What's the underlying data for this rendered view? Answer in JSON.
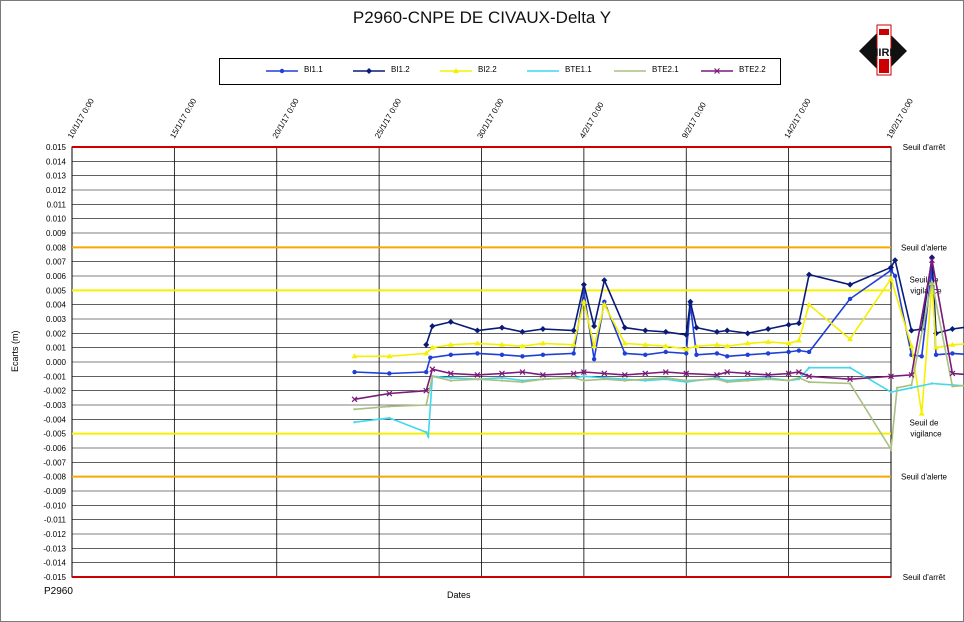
{
  "chart_data": {
    "type": "line",
    "title": "P2960-CNPE DE CIVAUX-Delta Y",
    "xlabel": "Dates",
    "ylabel": "Ecarts (m)",
    "footer": "P2960",
    "ylim": [
      -0.015,
      0.015
    ],
    "x_ticks": [
      "10/1/17 0:00",
      "15/1/17 0:00",
      "20/1/17 0:00",
      "25/1/17 0:00",
      "30/1/17 0:00",
      "4/2/17 0:00",
      "9/2/17 0:00",
      "14/2/17 0:00",
      "19/2/17 0:00"
    ],
    "y_ticks": [
      "0.015",
      "0.014",
      "0.013",
      "0.012",
      "0.011",
      "0.010",
      "0.009",
      "0.008",
      "0.007",
      "0.006",
      "0.005",
      "0.004",
      "0.003",
      "0.002",
      "0.001",
      "0.000",
      "-0.001",
      "-0.002",
      "-0.003",
      "-0.004",
      "-0.005",
      "-0.006",
      "-0.007",
      "-0.008",
      "-0.009",
      "-0.010",
      "-0.011",
      "-0.012",
      "-0.013",
      "-0.014",
      "-0.015"
    ],
    "thresholds": [
      {
        "value": 0.015,
        "label": "Seuil d'arrêt",
        "color": "#cc0000"
      },
      {
        "value": 0.008,
        "label": "Seuil d'alerte",
        "color": "#f5a800"
      },
      {
        "value": 0.005,
        "label": "Seuil de vigilance",
        "color": "#f5f000"
      },
      {
        "value": -0.005,
        "label": "Seuil de vigilance",
        "color": "#f5f000"
      },
      {
        "value": -0.008,
        "label": "Seuil d'alerte",
        "color": "#f5a800"
      },
      {
        "value": -0.015,
        "label": "Seuil d'arrêt",
        "color": "#cc0000"
      }
    ],
    "grid": true,
    "legend_position": "top",
    "series": [
      {
        "name": "BI1.1",
        "color": "#1f3fd6",
        "marker": "circle",
        "x": [
          13.8,
          15.5,
          17.3,
          17.5,
          18.5,
          19.8,
          21,
          22,
          23,
          24.5,
          25,
          25.5,
          26,
          27,
          28,
          29,
          30,
          30.2,
          30.5,
          31.5,
          32,
          33,
          34,
          35,
          35.5,
          36,
          38,
          40,
          40.2,
          41,
          41.5,
          42,
          42.2,
          43,
          44,
          45,
          46,
          46.8,
          47,
          47.1
        ],
        "y": [
          -0.0007,
          -0.0008,
          -0.0007,
          0.0003,
          0.0005,
          0.0006,
          0.0005,
          0.0004,
          0.0005,
          0.0006,
          0.0049,
          0.0002,
          0.0042,
          0.0006,
          0.0005,
          0.0007,
          0.0006,
          0.004,
          0.0005,
          0.0006,
          0.0004,
          0.0005,
          0.0006,
          0.0007,
          0.0008,
          0.0007,
          0.0044,
          0.0064,
          0.006,
          0.0005,
          0.0004,
          0.0066,
          0.0005,
          0.0006,
          0.0005,
          0.0004,
          0.0005,
          0.0003,
          0.0088,
          0.0004
        ]
      },
      {
        "name": "BI1.2",
        "color": "#0a1a78",
        "marker": "diamond",
        "x": [
          17.3,
          17.6,
          18.5,
          19.8,
          21,
          22,
          23,
          24.5,
          25,
          25.5,
          26,
          27,
          28,
          29,
          30,
          30.2,
          30.5,
          31.5,
          32,
          33,
          34,
          35,
          35.5,
          36,
          38,
          40,
          40.2,
          41,
          41.5,
          42,
          42.2,
          43,
          44,
          45,
          46,
          46.8,
          47,
          47.1
        ],
        "y": [
          0.0012,
          0.0025,
          0.0028,
          0.0022,
          0.0024,
          0.0021,
          0.0023,
          0.0022,
          0.0054,
          0.0025,
          0.0057,
          0.0024,
          0.0022,
          0.0021,
          0.0019,
          0.0042,
          0.0024,
          0.0021,
          0.0022,
          0.002,
          0.0023,
          0.0026,
          0.0027,
          0.0061,
          0.0054,
          0.0066,
          0.0071,
          0.0022,
          0.0023,
          0.0073,
          0.002,
          0.0023,
          0.0025,
          0.0024,
          0.0022,
          0.0019,
          0.0097,
          0.0014
        ]
      },
      {
        "name": "BI2.2",
        "color": "#f5f000",
        "marker": "triangle",
        "x": [
          13.8,
          15.5,
          17.3,
          17.6,
          18.5,
          19.8,
          21,
          22,
          23,
          24.5,
          25,
          25.5,
          26,
          27,
          28,
          29,
          30,
          30.5,
          31.5,
          32,
          33,
          34,
          35,
          35.5,
          36,
          38,
          40,
          41,
          41.5,
          42,
          42.2,
          43,
          44,
          45,
          46,
          46.8,
          47
        ],
        "y": [
          0.0004,
          0.0004,
          0.0006,
          0.001,
          0.0012,
          0.0013,
          0.0012,
          0.0011,
          0.0013,
          0.0012,
          0.0042,
          0.0011,
          0.004,
          0.0013,
          0.0012,
          0.0011,
          0.0009,
          0.0011,
          0.0012,
          0.0011,
          0.0013,
          0.0014,
          0.0013,
          0.0015,
          0.004,
          0.0016,
          0.0058,
          0.0011,
          -0.0036,
          0.0055,
          0.001,
          0.0012,
          0.0013,
          0.0012,
          0.0011,
          0.001,
          0.0009
        ]
      },
      {
        "name": "BTE1.1",
        "color": "#3fd8f0",
        "marker": "none",
        "x": [
          13.8,
          15.5,
          17.3,
          17.4,
          17.6,
          18.5,
          19.8,
          21,
          22,
          23,
          24.5,
          25,
          26,
          27,
          28,
          29,
          30,
          31.5,
          32,
          33,
          34,
          35,
          35.5,
          36,
          38,
          40,
          41,
          42,
          43,
          44,
          45,
          46,
          47
        ],
        "y": [
          -0.0042,
          -0.0039,
          -0.0049,
          -0.0052,
          -0.001,
          -0.0011,
          -0.0012,
          -0.0011,
          -0.0013,
          -0.0012,
          -0.0011,
          -0.001,
          -0.0011,
          -0.0012,
          -0.0013,
          -0.0012,
          -0.0014,
          -0.0011,
          -0.0013,
          -0.0012,
          -0.0011,
          -0.0013,
          -0.0012,
          -0.0004,
          -0.0004,
          -0.0021,
          -0.0018,
          -0.0015,
          -0.0016,
          -0.0017,
          -0.0016,
          -0.0015,
          -0.0017
        ]
      },
      {
        "name": "BTE2.1",
        "color": "#a8c080",
        "marker": "none",
        "x": [
          13.8,
          15.5,
          17.3,
          17.6,
          18.5,
          19.8,
          21,
          22,
          23,
          24.5,
          25,
          26,
          27,
          28,
          29,
          30,
          31.5,
          32,
          33,
          34,
          35,
          35.5,
          36,
          38,
          40,
          40.3,
          41,
          42,
          43,
          44,
          45,
          46,
          46.8,
          47
        ],
        "y": [
          -0.0033,
          -0.0031,
          -0.003,
          -0.001,
          -0.0013,
          -0.0012,
          -0.0013,
          -0.0014,
          -0.0012,
          -0.0011,
          -0.0013,
          -0.0012,
          -0.0013,
          -0.0012,
          -0.0011,
          -0.0013,
          -0.0012,
          -0.0014,
          -0.0013,
          -0.0012,
          -0.0013,
          -0.0011,
          -0.0014,
          -0.0015,
          -0.0061,
          -0.0018,
          -0.0016,
          0.0056,
          -0.0017,
          -0.0016,
          -0.0017,
          -0.0015,
          -0.005,
          -0.0016
        ]
      },
      {
        "name": "BTE2.2",
        "color": "#7a1a7a",
        "marker": "x",
        "x": [
          13.8,
          15.5,
          17.3,
          17.6,
          18.5,
          19.8,
          21,
          22,
          23,
          24.5,
          25,
          26,
          27,
          28,
          29,
          30,
          31.5,
          32,
          33,
          34,
          35,
          35.5,
          36,
          38,
          40,
          41,
          42,
          43,
          44,
          45,
          46,
          47
        ],
        "y": [
          -0.0026,
          -0.0022,
          -0.002,
          -0.0005,
          -0.0008,
          -0.0009,
          -0.0008,
          -0.0007,
          -0.0009,
          -0.0008,
          -0.0007,
          -0.0008,
          -0.0009,
          -0.0008,
          -0.0007,
          -0.0008,
          -0.0009,
          -0.0007,
          -0.0008,
          -0.0009,
          -0.0008,
          -0.0007,
          -0.001,
          -0.0012,
          -0.001,
          -0.0009,
          0.0071,
          -0.0008,
          -0.0009,
          -0.001,
          -0.0011,
          -0.0012
        ]
      }
    ]
  }
}
